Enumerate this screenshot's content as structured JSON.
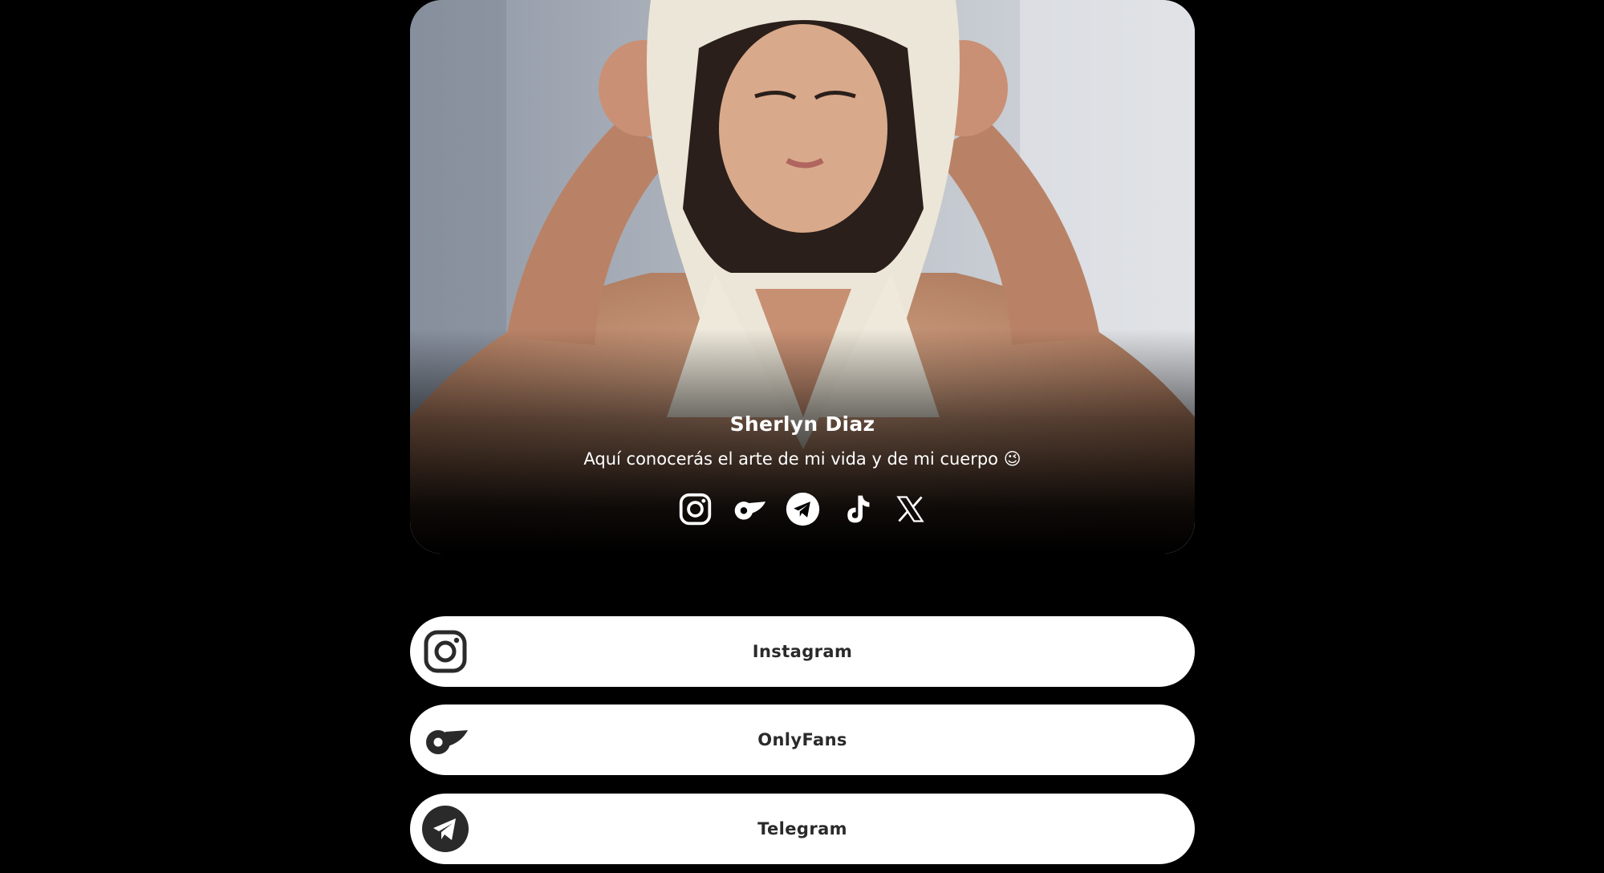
{
  "profile": {
    "name": "Sherlyn Diaz",
    "bio": "Aquí conocerás el arte de mi vida y de mi cuerpo 😉"
  },
  "social_icons": [
    {
      "icon": "instagram-icon",
      "label": "Instagram"
    },
    {
      "icon": "onlyfans-icon",
      "label": "OnlyFans"
    },
    {
      "icon": "telegram-icon",
      "label": "Telegram"
    },
    {
      "icon": "tiktok-icon",
      "label": "TikTok"
    },
    {
      "icon": "x-icon",
      "label": "X"
    }
  ],
  "links": [
    {
      "label": "Instagram",
      "icon": "instagram-icon"
    },
    {
      "label": "OnlyFans",
      "icon": "onlyfans-icon"
    },
    {
      "label": "Telegram",
      "icon": "telegram-icon"
    }
  ],
  "colors": {
    "background": "#000000",
    "button_bg": "#ffffff",
    "button_text": "#2a2a2a",
    "profile_text": "#ffffff"
  }
}
